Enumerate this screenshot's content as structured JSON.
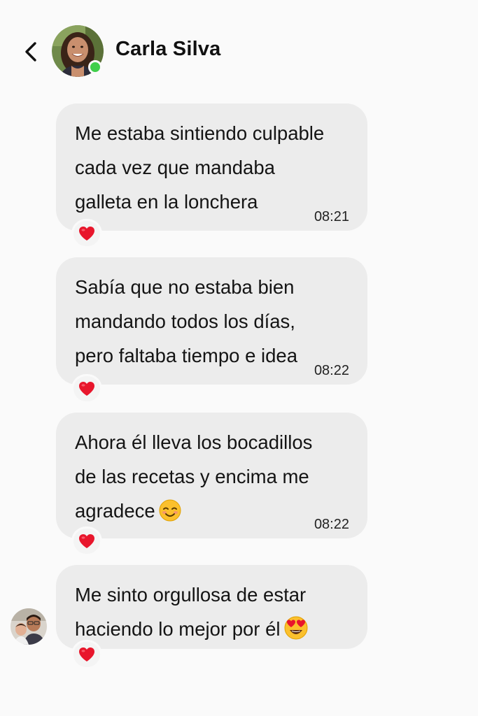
{
  "header": {
    "contact_name": "Carla Silva",
    "online": true,
    "back_icon": "chevron-left-icon"
  },
  "messages": [
    {
      "text": "Me estaba sintiendo culpable\ncada vez que mandaba\ngalleta en la lonchera",
      "time": "08:21",
      "reaction": "red-heart"
    },
    {
      "text": "Sabía que no estaba bien\nmandando todos los días,\npero faltaba tiempo e idea",
      "time": "08:22",
      "reaction": "red-heart"
    },
    {
      "text": "Ahora él lleva los bocadillos\nde las recetas y encima me\nagradece",
      "emoji": "smiling-face-with-smiling-eyes",
      "time": "08:22",
      "reaction": "red-heart"
    },
    {
      "text": "Me sinto orgullosa de estar\nhaciendo lo mejor por él",
      "emoji": "heart-eyes",
      "time": "",
      "reaction": "red-heart"
    }
  ],
  "colors": {
    "background": "#fafafa",
    "bubble": "#ececec",
    "online": "#3fcf4a",
    "heart": "#e8162c"
  }
}
